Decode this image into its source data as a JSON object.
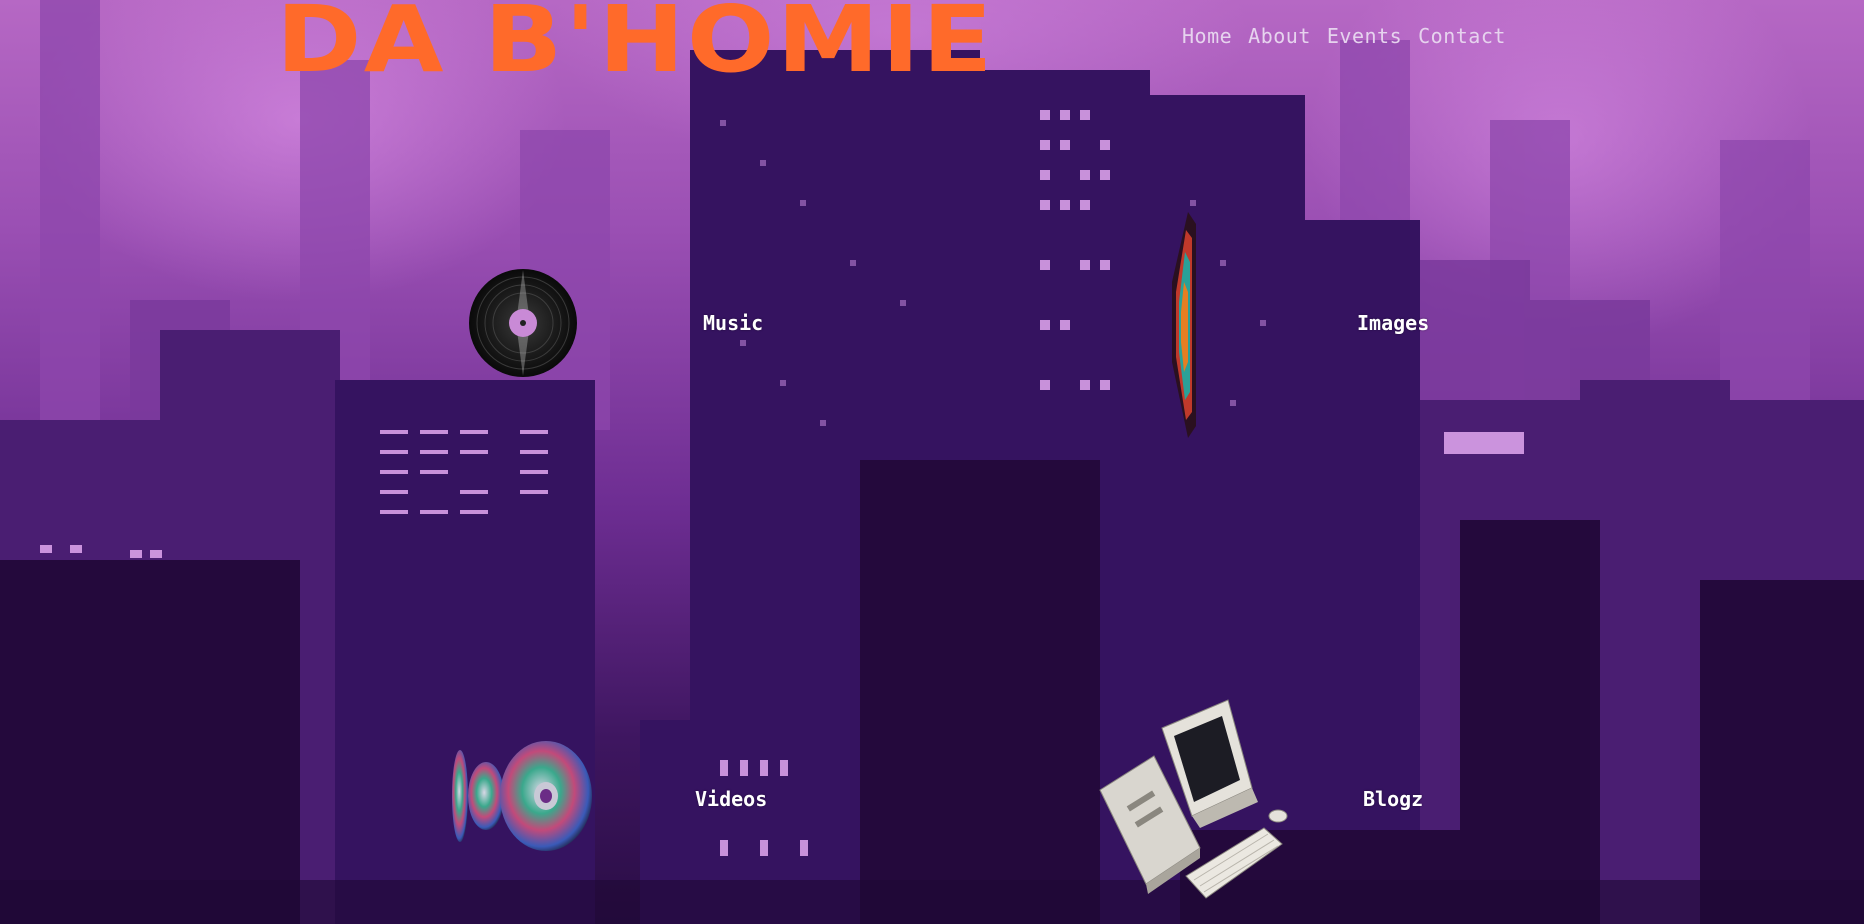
{
  "header": {
    "brand": "DA B'HOMIE",
    "nav": [
      "Home",
      "About",
      "Events",
      "Contact"
    ]
  },
  "tiles": {
    "music": {
      "label": "Music",
      "icon": "vinyl-record-icon"
    },
    "images": {
      "label": "Images",
      "icon": "framed-picture-icon"
    },
    "videos": {
      "label": "Videos",
      "icon": "dvd-discs-icon"
    },
    "blogz": {
      "label": "Blogz",
      "icon": "desktop-computer-icon"
    }
  },
  "colors": {
    "brand": "#ff6a2a",
    "nav_text": "#e6d3ee",
    "label_text": "#ffffff",
    "sky": "#9a4fb3",
    "buildings": "#2a0d45"
  }
}
